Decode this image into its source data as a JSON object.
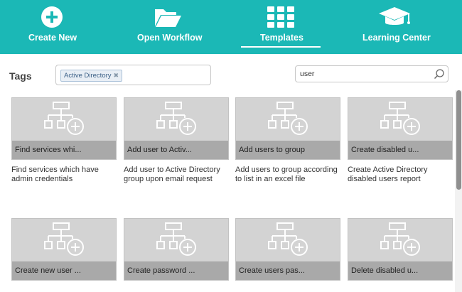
{
  "nav": {
    "items": [
      {
        "label": "Create New",
        "icon": "plus-circle-icon"
      },
      {
        "label": "Open Workflow",
        "icon": "folder-icon"
      },
      {
        "label": "Templates",
        "icon": "grid-icon",
        "active": true
      },
      {
        "label": "Learning Center",
        "icon": "graduation-cap-icon"
      }
    ]
  },
  "filters": {
    "tags_label": "Tags",
    "tags": [
      "Active Directory"
    ],
    "search_value": "user"
  },
  "templates": [
    {
      "caption": "Find services whi...",
      "description": "Find services which have admin credentials"
    },
    {
      "caption": "Add user to Activ...",
      "description": "Add user to Active Directory group upon email request"
    },
    {
      "caption": "Add users to group",
      "description": "Add users to group according to list in an excel file"
    },
    {
      "caption": "Create disabled u...",
      "description": "Create Active Directory disabled users report"
    },
    {
      "caption": "Create new user ...",
      "description": ""
    },
    {
      "caption": "Create password ...",
      "description": ""
    },
    {
      "caption": "Create users pas...",
      "description": ""
    },
    {
      "caption": "Delete disabled u...",
      "description": ""
    }
  ],
  "colors": {
    "header": "#1bb8b6",
    "thumb": "#d3d3d3",
    "caption_bar": "#a9a9a9"
  }
}
